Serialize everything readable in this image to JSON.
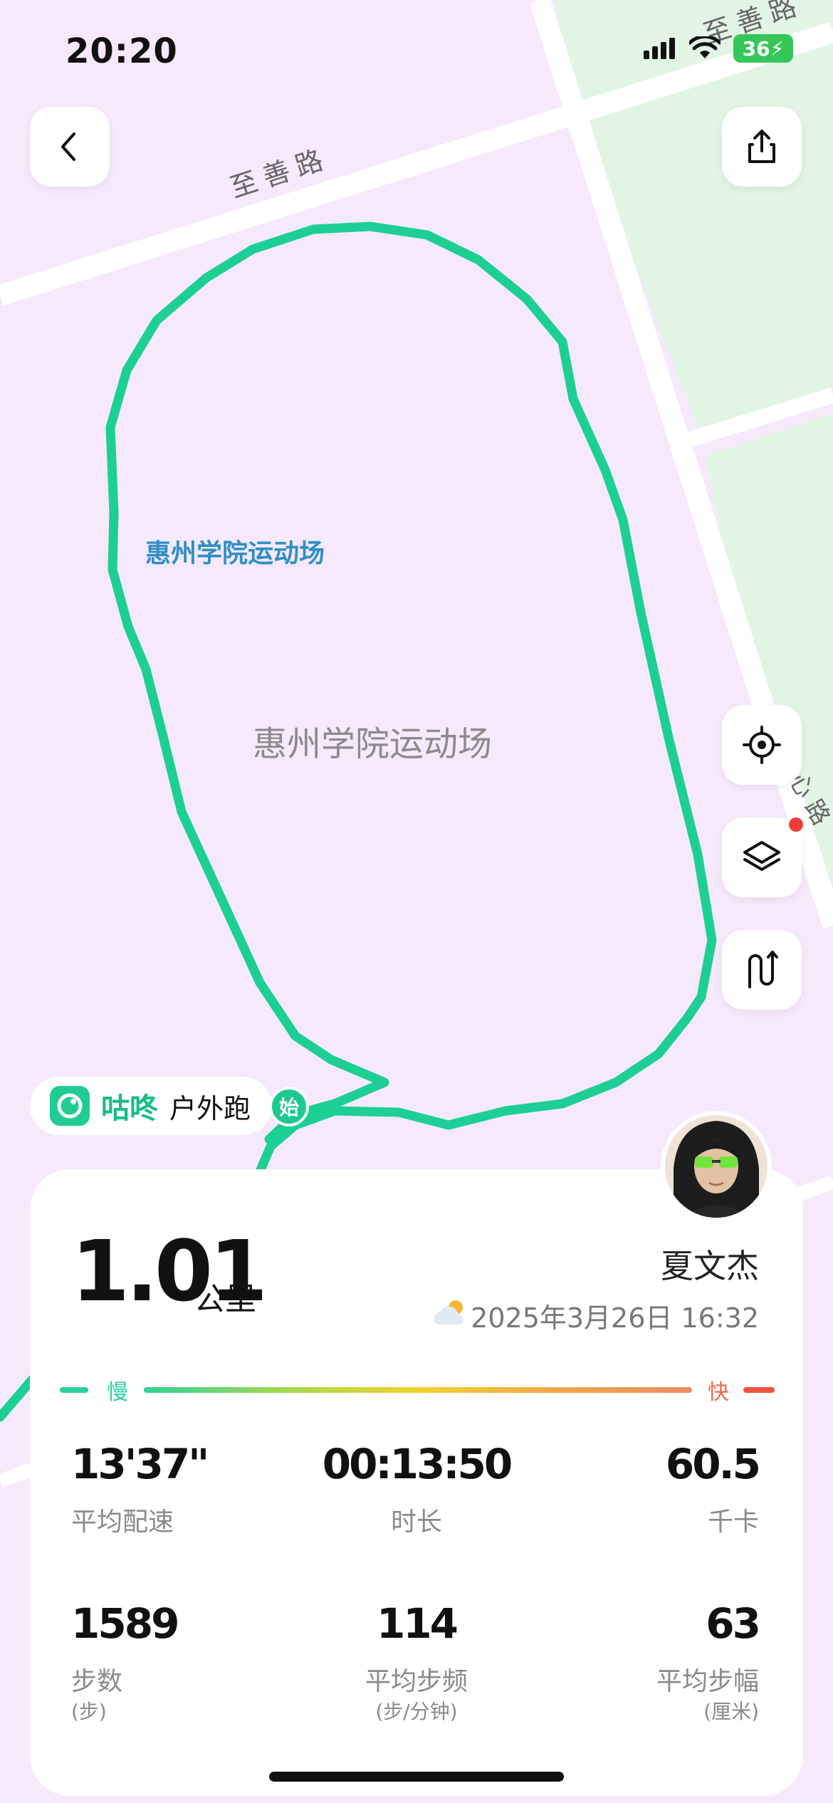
{
  "status": {
    "time": "20:20",
    "battery": "36"
  },
  "map": {
    "road_label_1": "至善路",
    "road_label_2": "至善路",
    "road_label_3": "心路",
    "poi_label_blue": "惠州学院运动场",
    "poi_label_gray": "惠州学院运动场",
    "start_marker": "始"
  },
  "app": {
    "name": "咕咚",
    "activity_type": "户外跑"
  },
  "summary": {
    "distance": "1.01",
    "distance_unit": "公里",
    "user_name": "夏文杰",
    "date": "2025年3月26日 16:32"
  },
  "pace_scale": {
    "slow_label": "慢",
    "fast_label": "快"
  },
  "stats": [
    {
      "value": "13'37\"",
      "label": "平均配速",
      "unit": ""
    },
    {
      "value": "00:13:50",
      "label": "时长",
      "unit": ""
    },
    {
      "value": "60.5",
      "label": "千卡",
      "unit": ""
    },
    {
      "value": "1589",
      "label": "步数",
      "unit": "(步)"
    },
    {
      "value": "114",
      "label": "平均步频",
      "unit": "(步/分钟)"
    },
    {
      "value": "63",
      "label": "平均步幅",
      "unit": "(厘米)"
    }
  ],
  "colors": {
    "route": "#1dcf95",
    "map_background": "#f6e9fb",
    "green_area": "#e2f5e5",
    "brand": "#15bd86"
  },
  "icons": [
    "back-icon",
    "share-icon",
    "locate-icon",
    "layers-icon",
    "route-toggle-icon",
    "weather-icon",
    "app-logo-icon"
  ]
}
